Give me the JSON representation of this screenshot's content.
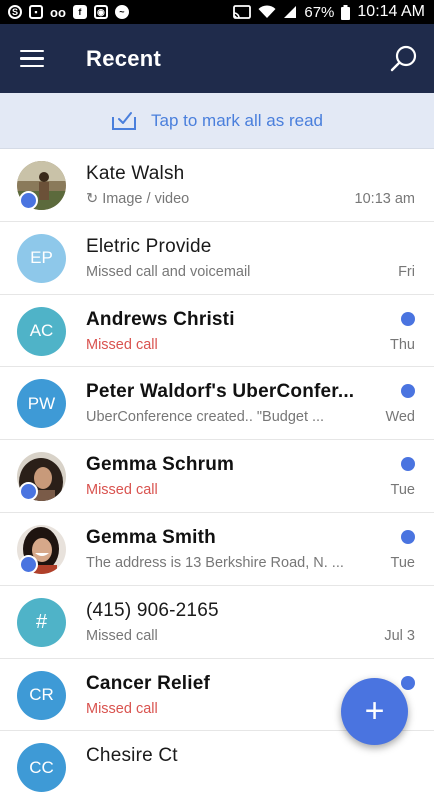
{
  "status_bar": {
    "battery": "67%",
    "time": "10:14 AM"
  },
  "app_bar": {
    "title": "Recent"
  },
  "mark_all": {
    "label": "Tap to mark all as read"
  },
  "conversations": [
    {
      "name": "Kate Walsh",
      "subtitle": "Image / video",
      "subtitle_prefix": "↻",
      "time": "10:13 am",
      "avatar_type": "photo",
      "unread": false,
      "missed": false,
      "name_bold": false
    },
    {
      "name": "Eletric Provide",
      "subtitle": "Missed call and voicemail",
      "time": "Fri",
      "avatar_initials": "EP",
      "avatar_color": "#8ec8ea",
      "unread": false,
      "missed": false,
      "name_bold": false
    },
    {
      "name": "Andrews Christi",
      "subtitle": "Missed call",
      "time": "Thu",
      "avatar_initials": "AC",
      "avatar_color": "#4fb3c8",
      "unread": true,
      "missed": true,
      "name_bold": true
    },
    {
      "name": "Peter Waldorf's UberConfer...",
      "subtitle": "UberConference created.. \"Budget ...",
      "time": "Wed",
      "avatar_initials": "PW",
      "avatar_color": "#3e9ad6",
      "unread": true,
      "missed": false,
      "name_bold": true
    },
    {
      "name": "Gemma Schrum",
      "subtitle": "Missed call",
      "time": "Tue",
      "avatar_type": "photo",
      "unread": true,
      "missed": true,
      "name_bold": true
    },
    {
      "name": "Gemma Smith",
      "subtitle": "The address is 13 Berkshire Road, N. ...",
      "time": "Tue",
      "avatar_type": "photo",
      "unread": true,
      "missed": false,
      "name_bold": true
    },
    {
      "name": "(415) 906-2165",
      "subtitle": "Missed call",
      "time": "Jul 3",
      "avatar_initials": "#",
      "avatar_color": "#4fb3c8",
      "unread": false,
      "missed": false,
      "name_bold": false
    },
    {
      "name": "Cancer Relief",
      "subtitle": "Missed call",
      "time": "",
      "avatar_initials": "CR",
      "avatar_color": "#3e9ad6",
      "unread": true,
      "missed": true,
      "name_bold": true
    },
    {
      "name": "Chesire Ct",
      "subtitle": "",
      "time": "",
      "avatar_initials": "CC",
      "avatar_color": "#3e9ad6",
      "unread": false,
      "missed": false,
      "name_bold": false
    }
  ],
  "fab": {
    "label": "+"
  },
  "colors": {
    "app_bar": "#1f2b4b",
    "accent": "#4a74e0",
    "missed": "#d9534f",
    "mark_bar_bg": "#e3e9f5"
  }
}
